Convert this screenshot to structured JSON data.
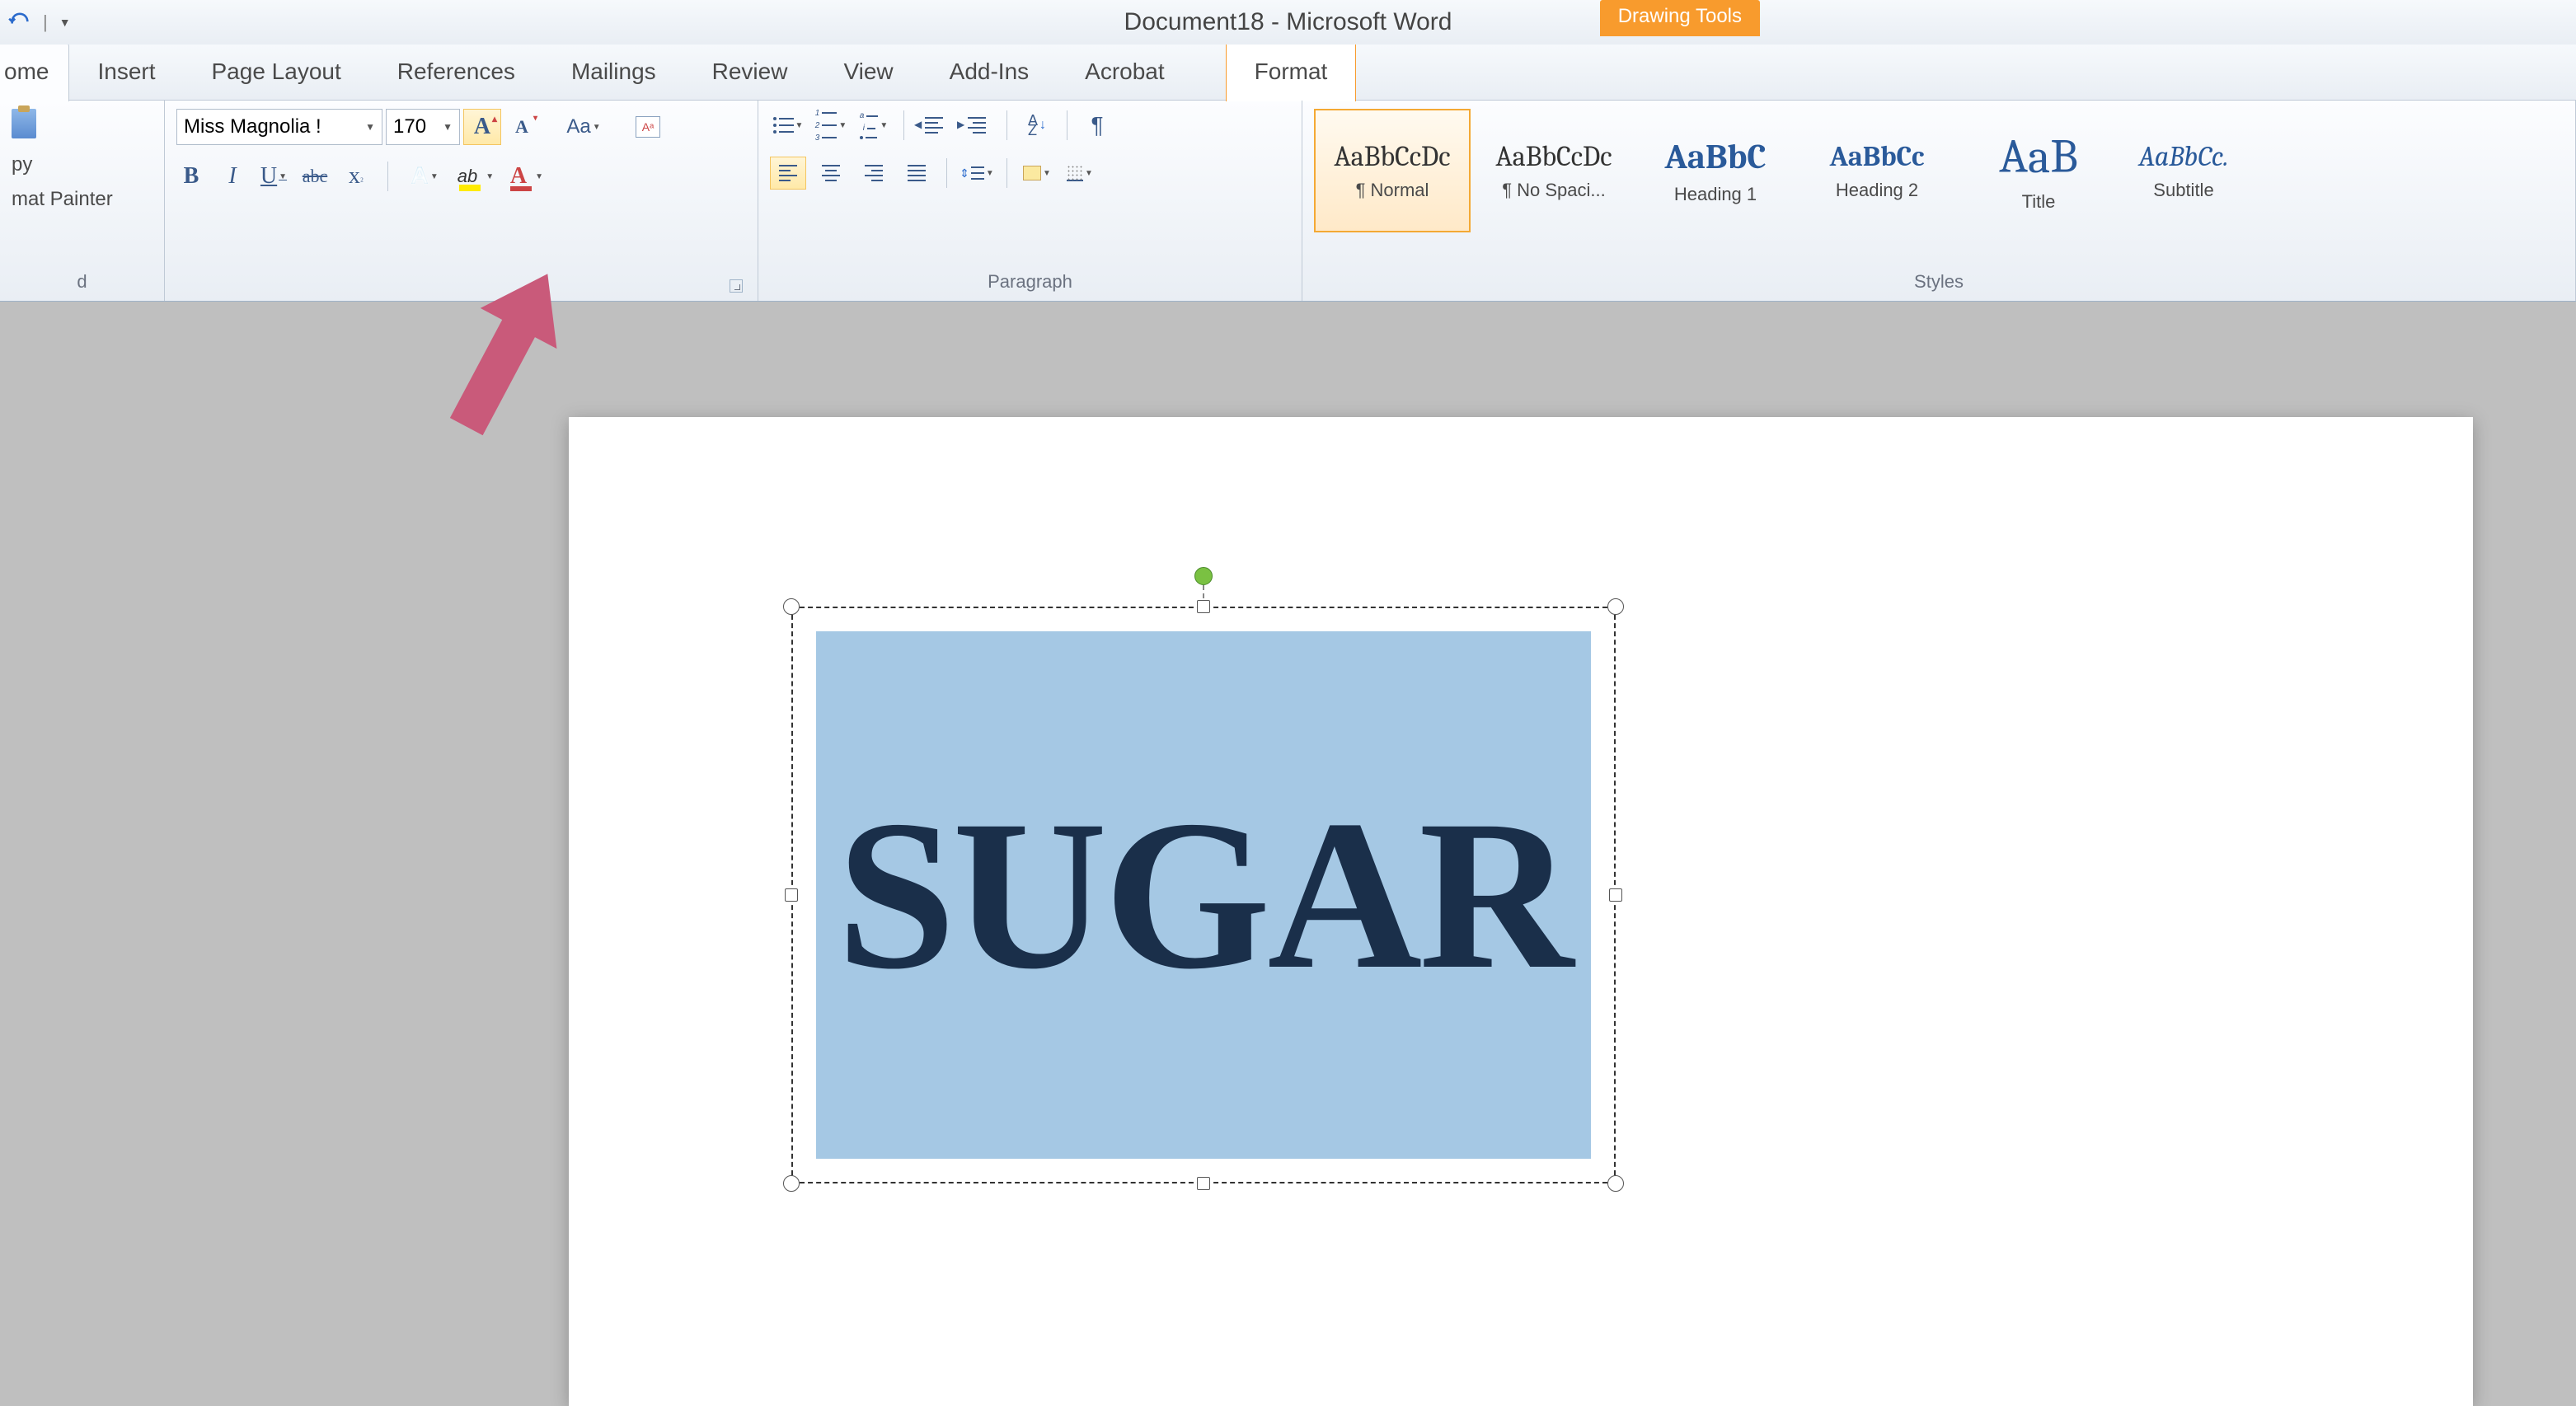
{
  "title": "Document18  -  Microsoft Word",
  "contextual_tab": "Drawing Tools",
  "tabs": {
    "home": "ome",
    "insert": "Insert",
    "page_layout": "Page Layout",
    "references": "References",
    "mailings": "Mailings",
    "review": "Review",
    "view": "View",
    "addins": "Add-Ins",
    "acrobat": "Acrobat",
    "format": "Format"
  },
  "clipboard": {
    "copy": "py",
    "format_painter": "mat Painter",
    "label": "d"
  },
  "font": {
    "name": "Miss Magnolia !",
    "size": "170",
    "grow": "A",
    "shrink": "A",
    "case": "Aa",
    "bold": "B",
    "italic": "I",
    "underline": "U",
    "strike": "abc",
    "sub": "x",
    "texteff": "A",
    "hilite": "ab",
    "fontcolor": "A",
    "clearfmt": "Aᵃ"
  },
  "paragraph": {
    "label": "Paragraph",
    "pilcrow": "¶",
    "sort_a": "A",
    "sort_z": "Z"
  },
  "styles": {
    "label": "Styles",
    "items": [
      {
        "preview": "AaBbCcDc",
        "name": "¶ Normal"
      },
      {
        "preview": "AaBbCcDc",
        "name": "¶ No Spaci..."
      },
      {
        "preview": "AaBbC",
        "name": "Heading 1"
      },
      {
        "preview": "AaBbCc",
        "name": "Heading 2"
      },
      {
        "preview": "AaB",
        "name": "Title"
      },
      {
        "preview": "AaBbCc.",
        "name": "Subtitle"
      }
    ]
  },
  "document": {
    "textbox_content": "SUGAR"
  }
}
